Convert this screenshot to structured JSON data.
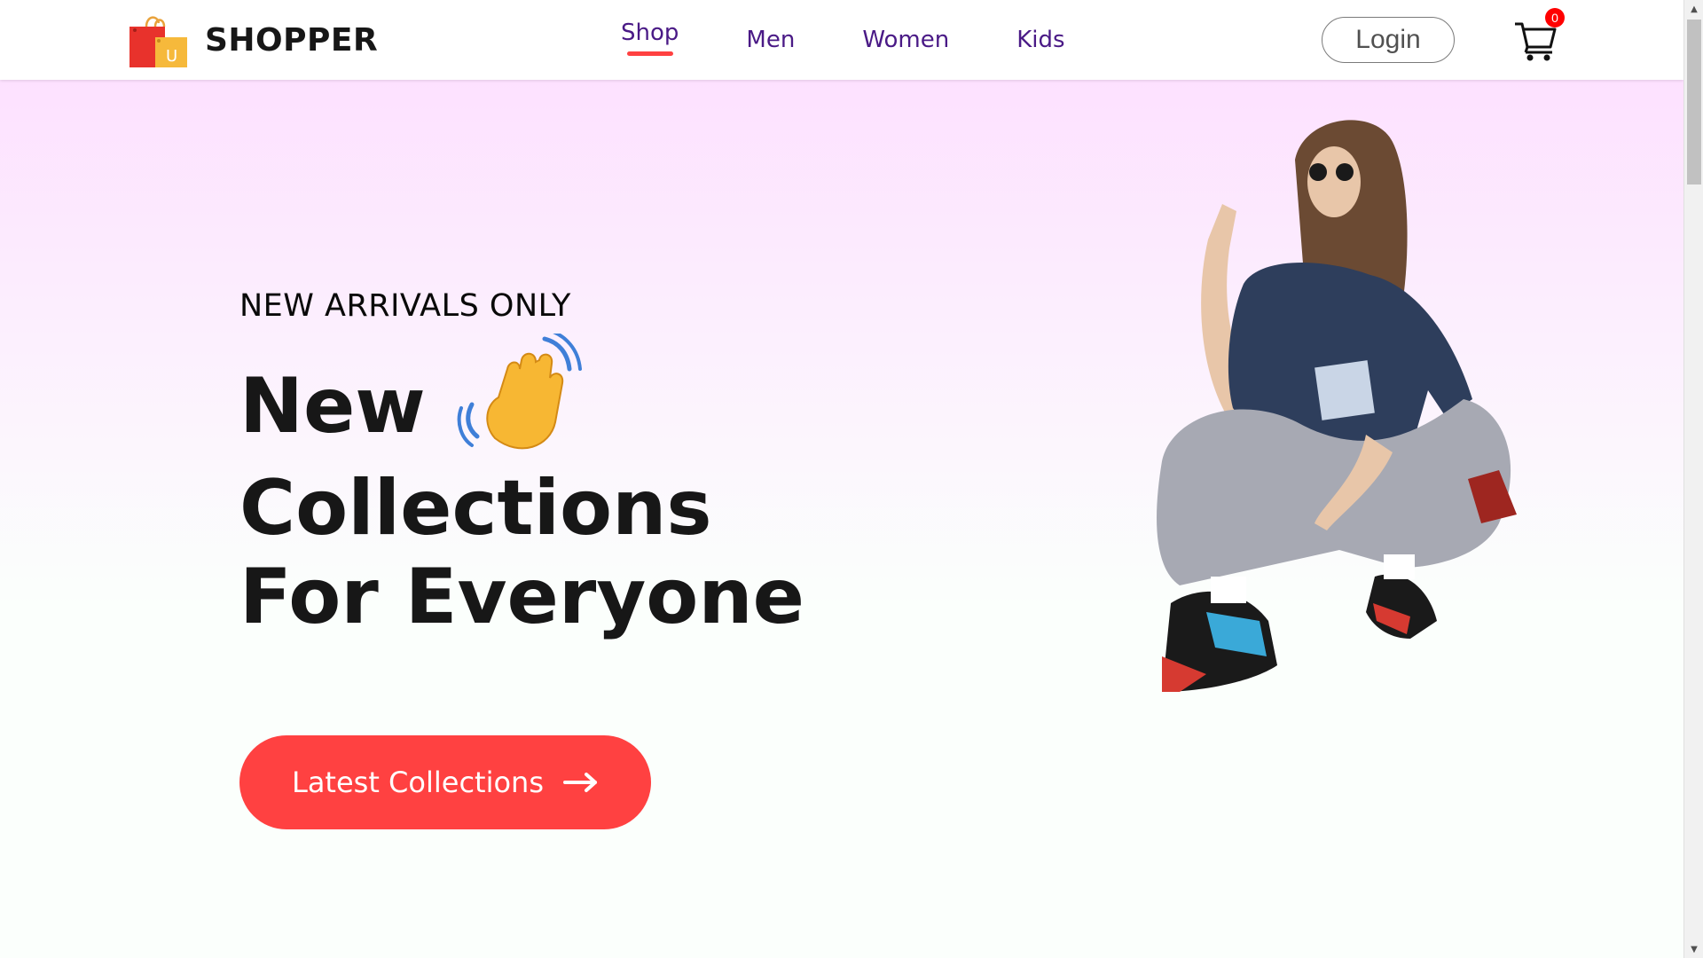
{
  "navbar": {
    "brand": "SHOPPER",
    "logo_icon": "shopping-bag-icon",
    "menu": [
      {
        "label": "Shop",
        "active": true
      },
      {
        "label": "Men",
        "active": false
      },
      {
        "label": "Women",
        "active": false
      },
      {
        "label": "Kids",
        "active": false
      }
    ],
    "login_label": "Login",
    "cart_icon": "cart-icon",
    "cart_count": "0"
  },
  "hero": {
    "kicker": "NEW ARRIVALS ONLY",
    "title_line1": "New",
    "hand_icon": "waving-hand-icon",
    "title_line2": "Collections",
    "title_line3": "For Everyone",
    "button_label": "Latest Collections",
    "button_icon": "arrow-right-icon"
  },
  "colors": {
    "accent": "#ff4141",
    "nav_text": "#4a1a86",
    "hero_top": "#fde1ff",
    "hero_bottom": "#fafffc"
  }
}
